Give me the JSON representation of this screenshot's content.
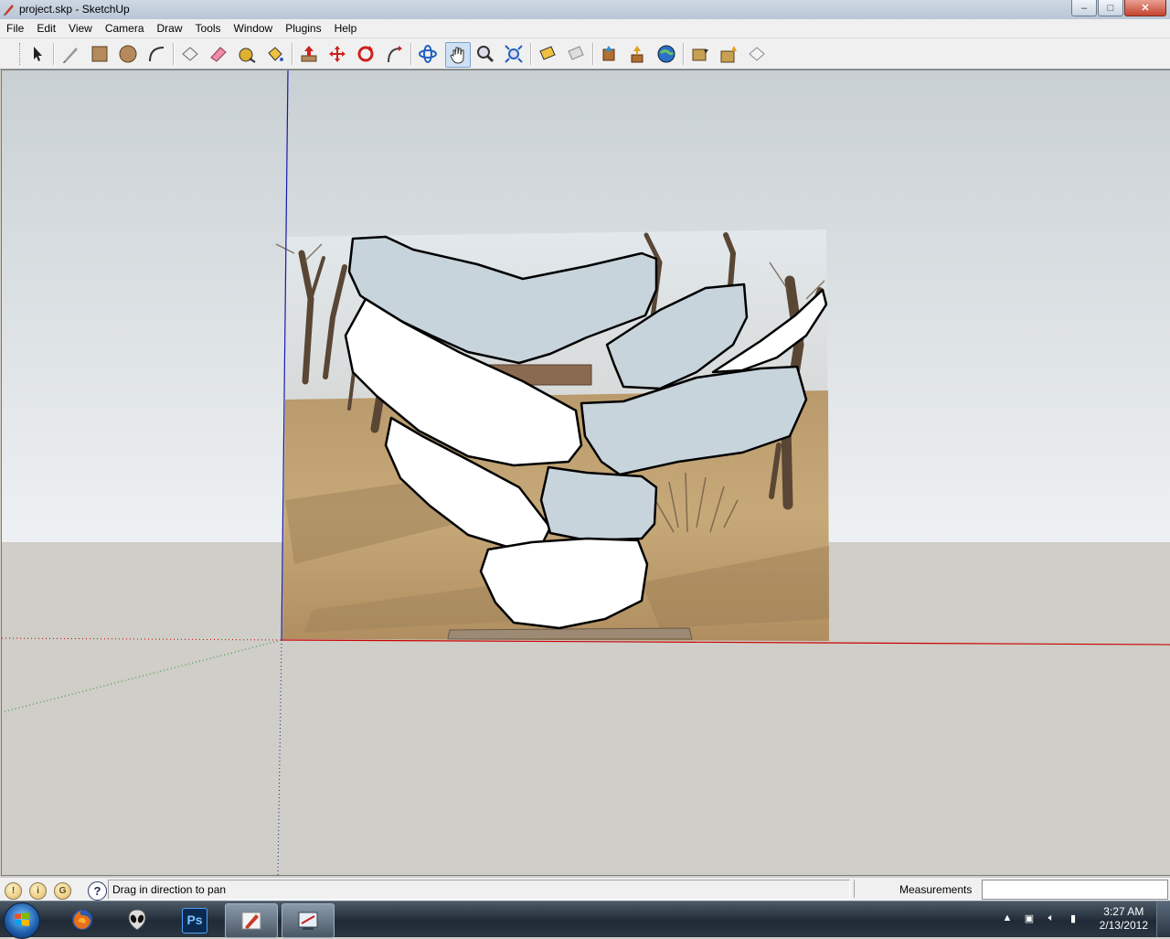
{
  "window": {
    "title": "project.skp - SketchUp",
    "controls": {
      "minimize": "‒",
      "maximize": "□",
      "close": "✕"
    }
  },
  "menu": [
    "File",
    "Edit",
    "View",
    "Camera",
    "Draw",
    "Tools",
    "Window",
    "Plugins",
    "Help"
  ],
  "toolbar": {
    "tools": [
      "select-icon",
      "line-pencil-icon",
      "rectangle-icon",
      "circle-icon",
      "arc-icon",
      "make-component-icon",
      "eraser-icon",
      "tape-measure-icon",
      "paint-bucket-icon",
      "push-pull-icon",
      "move-icon",
      "rotate-icon",
      "follow-me-icon",
      "orbit-icon",
      "pan-icon",
      "zoom-icon",
      "zoom-extents-icon",
      "section-plane-icon",
      "section-cut-icon",
      "get-models-icon",
      "share-model-icon",
      "preview-google-earth-icon",
      "components-down-icon",
      "components-up-icon",
      "components-share-icon"
    ]
  },
  "colors": {
    "sky": "#dde3e6",
    "ground": "#cfcec8",
    "axis_red": "#cc0000",
    "axis_blue": "#1a1aa8",
    "axis_green": "#2a8a2a",
    "stone_blue": "#c8d4dc",
    "stone_white": "#ffffff"
  },
  "status": {
    "hint": "Drag in direction to pan",
    "help_icon": "question-icon",
    "measurements_label": "Measurements",
    "measurements_value": ""
  },
  "taskbar": {
    "apps": [
      "windows-start-icon",
      "firefox-icon",
      "alien-app-icon",
      "photoshop-icon",
      "sketchup-icon",
      "paint-app-icon"
    ],
    "photoshop_label": "Ps",
    "time": "3:27 AM",
    "date": "2/13/2012"
  }
}
